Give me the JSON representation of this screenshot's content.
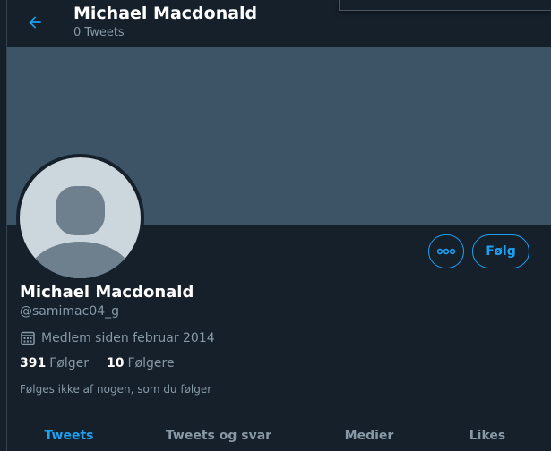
{
  "header": {
    "name": "Michael Macdonald",
    "tweet_count": "0 Tweets"
  },
  "profile": {
    "name": "Michael Macdonald",
    "handle": "@samimac04_g",
    "joined": "Medlem siden februar 2014",
    "following_count": "391",
    "following_label": "Følger",
    "followers_count": "10",
    "followers_label": "Følgere",
    "followed_by_note": "Følges ikke af nogen, som du følger"
  },
  "actions": {
    "follow_label": "Følg"
  },
  "tabs": [
    {
      "label": "Tweets",
      "active": true
    },
    {
      "label": "Tweets og svar",
      "active": false
    },
    {
      "label": "Medier",
      "active": false
    },
    {
      "label": "Likes",
      "active": false
    }
  ],
  "colors": {
    "accent": "#1da1f2",
    "background": "#15202b",
    "banner": "#3d5466",
    "secondary_text": "#8899a6"
  },
  "icons": {
    "back": "arrow-left-icon",
    "more": "more-horizontal-icon",
    "calendar": "calendar-icon",
    "avatar": "default-avatar-icon"
  }
}
